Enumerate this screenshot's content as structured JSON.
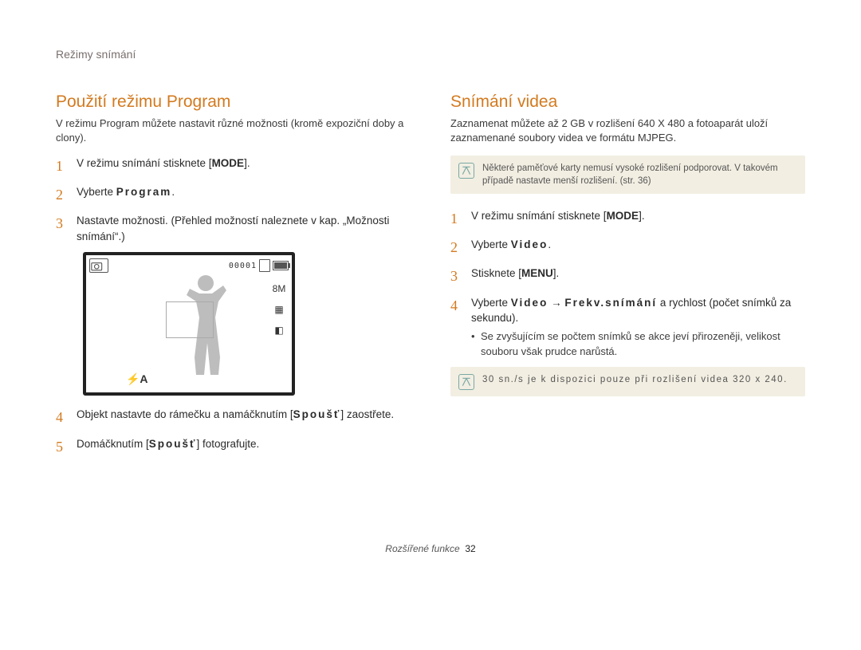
{
  "header": {
    "section_label": "Režimy snímání"
  },
  "left": {
    "title": "Použití režimu Program",
    "intro": "V režimu Program můžete nastavit různé možnosti (kromě expoziční doby a clony).",
    "steps": [
      {
        "num": "1",
        "body_prefix": "V režimu snímání stisknete [",
        "mode": "MODE",
        "body_suffix": "]."
      },
      {
        "num": "2",
        "body": "Vyberte",
        "mono": "Program",
        "suffix": "."
      },
      {
        "num": "3",
        "body": "Nastavte možnosti. (Přehled možností naleznete v kap. „Možnosti snímání“.)"
      },
      {
        "num": "4",
        "body": "Objekt nastavte do rámečku a namáčknutím [",
        "key": "Spoušť",
        "suffix": "] zaostřete."
      },
      {
        "num": "5",
        "body": "Domáčknutím [",
        "key": "Spoušť",
        "suffix": "] fotografujte."
      }
    ],
    "camera": {
      "counter": "00001",
      "flash": "⚡A",
      "right_icons": [
        "8M",
        "▦",
        "◧"
      ]
    }
  },
  "right": {
    "title": "Snímání videa",
    "intro": "Zaznamenat můžete až 2 GB v rozlišení 640 X 480 a fotoaparát uloží zaznamenané soubory videa ve formátu MJPEG.",
    "note": "Některé paměťové karty nemusí vysoké rozlišení podporovat. V takovém případě nastavte menší rozlišení. (str. 36)",
    "steps": [
      {
        "num": "1",
        "body_prefix": "V režimu snímání stisknete [",
        "mode": "MODE",
        "body_suffix": "]."
      },
      {
        "num": "2",
        "body": "Vyberte",
        "mono": "Video",
        "suffix": "."
      },
      {
        "num": "3",
        "body": "Stisknete [",
        "mode": "MENU",
        "suffix": "]."
      },
      {
        "num": "4",
        "body": "Vyberte",
        "mono1": "Video",
        "arrow": "→",
        "mono2": "Frekv.snímání",
        "suffix": " a rychlost (počet snímků za sekundu).",
        "sub": "Se zvyšujícím se počtem snímků se akce jeví přirozeněji, velikost souboru však prudce narůstá."
      }
    ],
    "note2": "30 sn./s je k dispozici pouze při rozlišení videa 320 x 240."
  },
  "pager": {
    "label": "Rozšířené funkce",
    "page": "32"
  }
}
